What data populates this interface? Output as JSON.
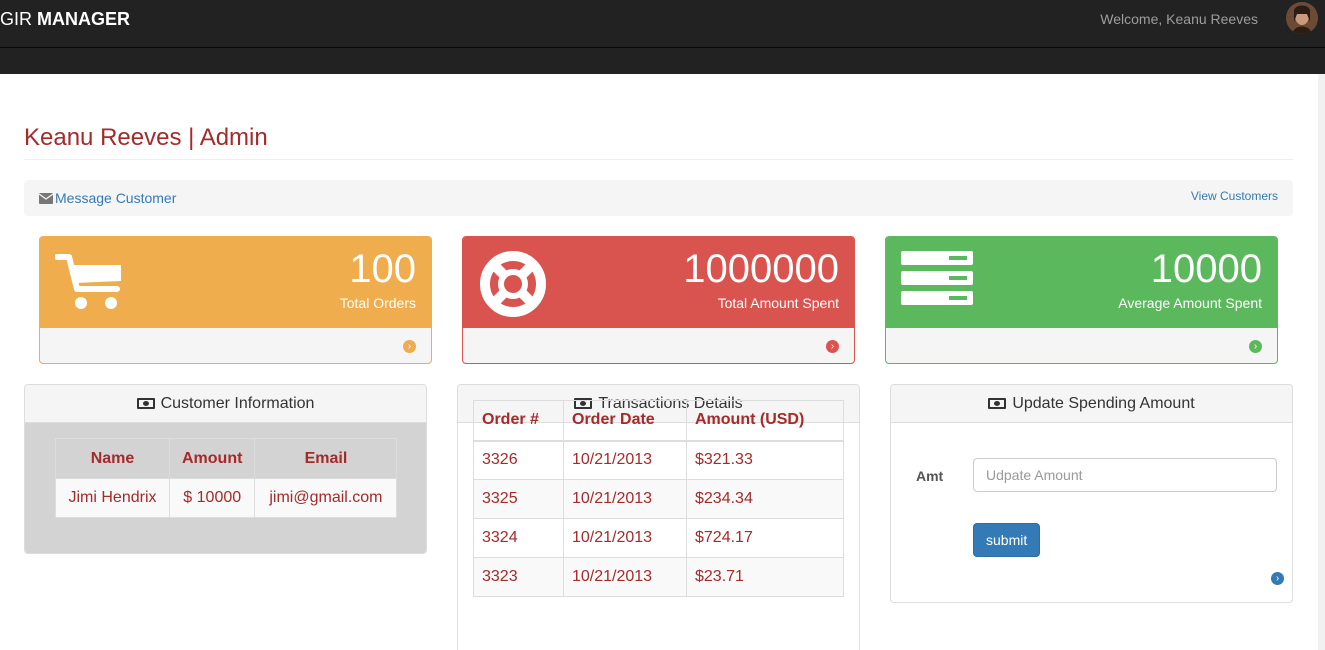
{
  "navbar": {
    "brand_prefix": "GIR ",
    "brand_bold": "MANAGER",
    "welcome": "Welcome, Keanu Reeves"
  },
  "page": {
    "title": "Keanu Reeves | Admin"
  },
  "actions": {
    "message_customer": "Message Customer",
    "view_customers": "View Customers"
  },
  "stats": [
    {
      "value": "100",
      "label": "Total Orders",
      "color": "#f0ad4e",
      "icon": "shopping-cart-icon"
    },
    {
      "value": "1000000",
      "label": "Total Amount Spent",
      "color": "#d9534f",
      "icon": "life-ring-icon"
    },
    {
      "value": "10000",
      "label": "Average Amount Spent",
      "color": "#5cb85c",
      "icon": "server-icon"
    }
  ],
  "customer_info": {
    "title": "Customer Information",
    "headers": [
      "Name",
      "Amount",
      "Email"
    ],
    "rows": [
      [
        "Jimi Hendrix",
        "$ 10000",
        "jimi@gmail.com"
      ]
    ]
  },
  "transactions": {
    "title": "Transactions Details",
    "headers": [
      "Order #",
      "Order Date",
      "Amount (USD)"
    ],
    "rows": [
      [
        "3326",
        "10/21/2013",
        "$321.33"
      ],
      [
        "3325",
        "10/21/2013",
        "$234.34"
      ],
      [
        "3324",
        "10/21/2013",
        "$724.17"
      ],
      [
        "3323",
        "10/21/2013",
        "$23.71"
      ]
    ]
  },
  "update_spending": {
    "title": "Update Spending Amount",
    "label": "Amt",
    "placeholder": "Udpate Amount",
    "submit": "submit"
  },
  "colors": {
    "accent": "#a52a2a",
    "link": "#337ab7",
    "warning": "#f0ad4e",
    "danger": "#d9534f",
    "success": "#5cb85c"
  }
}
